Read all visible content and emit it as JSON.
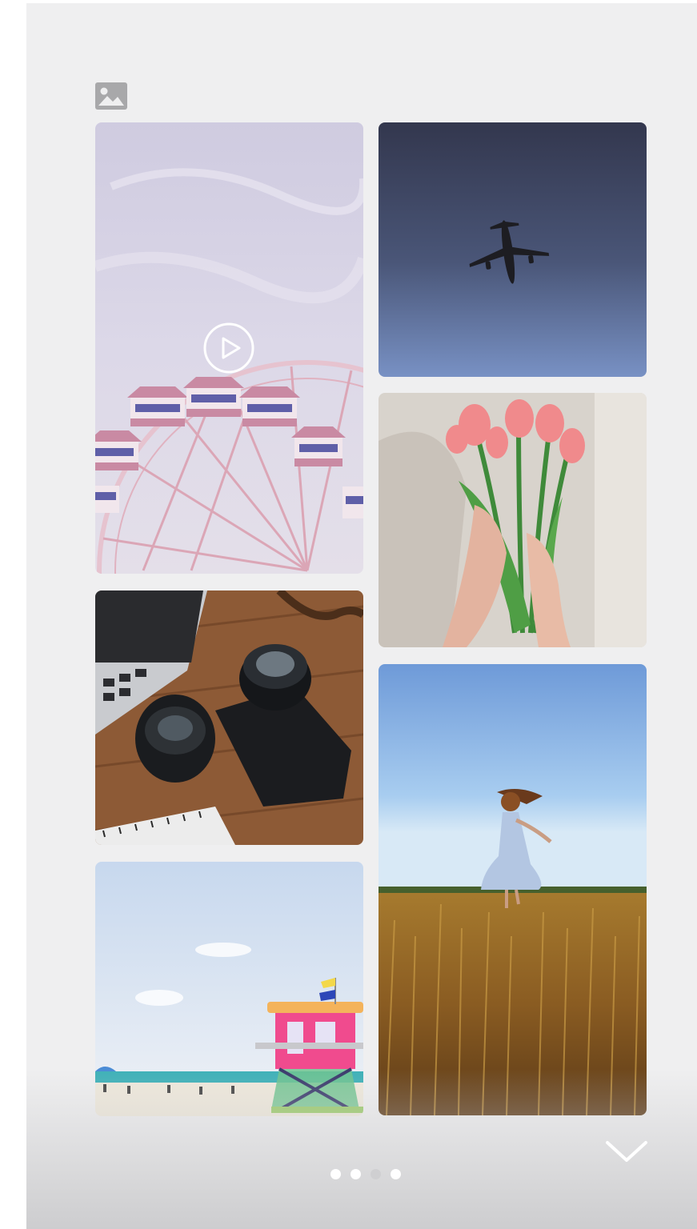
{
  "header": {
    "icon": "gallery-icon"
  },
  "gallery": {
    "tiles": [
      {
        "subject": "ferris-wheel",
        "type": "video",
        "overlay_icon": "play-icon"
      },
      {
        "subject": "airplane",
        "type": "photo"
      },
      {
        "subject": "tulips",
        "type": "photo"
      },
      {
        "subject": "cameras",
        "type": "photo"
      },
      {
        "subject": "woman-in-field",
        "type": "photo"
      },
      {
        "subject": "beach-lifeguard-tower",
        "type": "photo"
      }
    ]
  },
  "pager": {
    "page_count": 4,
    "active_index": 3,
    "next_icon": "chevron-down-icon"
  },
  "colors": {
    "background": "#efeff0",
    "icon_gray": "#a8a8aa",
    "dot_active": "#ffffff",
    "dot_inactive": "#cfcfd1"
  }
}
